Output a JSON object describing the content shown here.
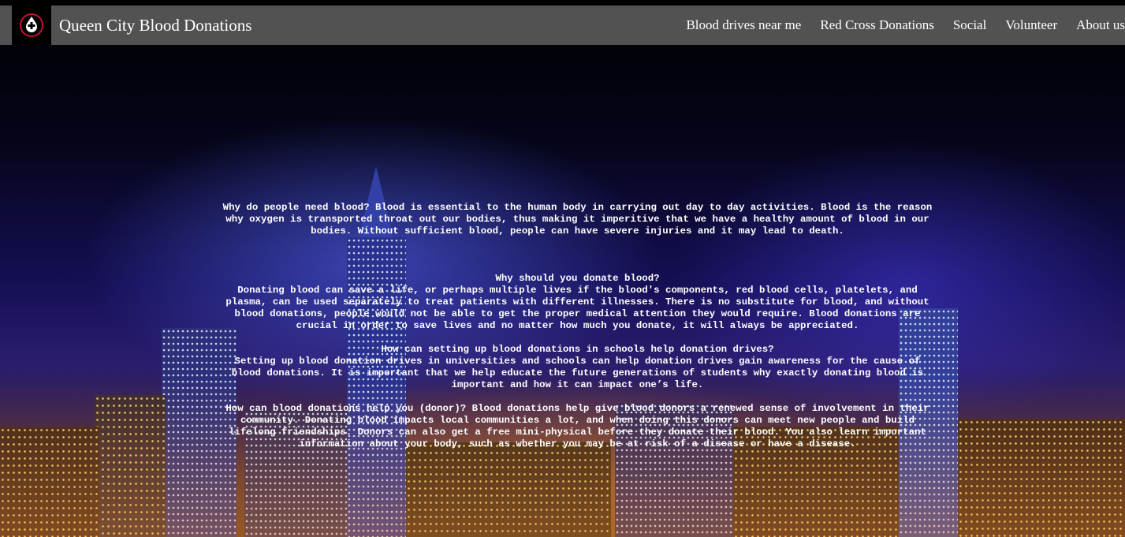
{
  "header": {
    "logo_icon": "blood-drop-cross-icon",
    "site_title": "Queen City Blood Donations",
    "nav": [
      "Blood drives near me",
      "Red Cross Donations",
      "Social",
      "Volunteer",
      "About us"
    ]
  },
  "content": {
    "why_need_blood": "Why do people need blood? Blood is essential to the human body in carrying out day to day activities. Blood is the reason why oxygen is transported throat out our bodies, thus making it imperitive that we have a healthy amount of blood in our bodies. Without sufficient blood, people can have severe injuries and it may lead to death.",
    "why_donate_title": "Why should you donate blood?",
    "why_donate_body": "Donating blood can save a life, or perhaps multiple lives if the blood's components, red blood cells, platelets, and plasma, can be used separately to treat patients with different illnesses. There is no substitute for blood, and without blood donations, people would not be able to get the proper medical attention they would require. Blood donations are crucial in order to save lives and no matter how much you donate, it will always be appreciated.",
    "schools_title": "How can setting up blood donations in schools help donation drives?",
    "schools_body": "Setting up blood donation drives in universities and schools can help donation drives gain awareness for the cause of blood donations. It is important that we help educate the future generations of students why exactly donating blood is important and how it can impact one’s life.",
    "donor_help": "How can blood donations help you (donor)? Blood donations help give blood donors a renewed sense of involvement in their community. Donating blood impacts local communities a lot, and when doing this donors can meet new people and build lifelong friendships. Donors can also get a free mini-physical before they donate their blood. You also learn important information about your body, such as whether you may be at risk of a disease or have a disease."
  },
  "colors": {
    "navbar_bg": "#555555",
    "text": "#ffffff",
    "logo_accent": "#c8102e"
  }
}
